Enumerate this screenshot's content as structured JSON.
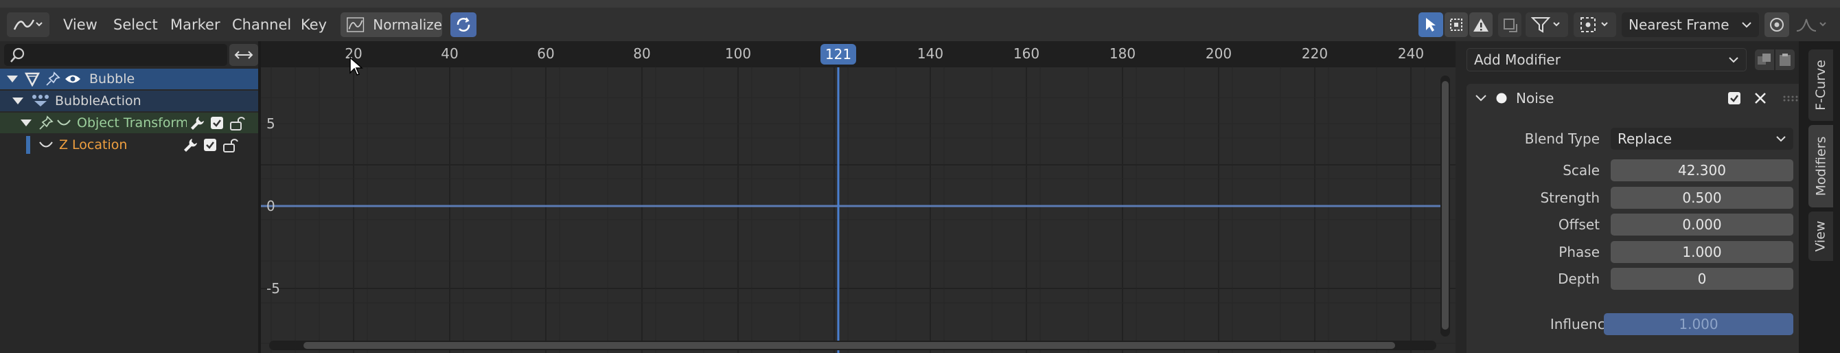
{
  "header": {
    "menus": [
      "View",
      "Select",
      "Marker",
      "Channel",
      "Key"
    ],
    "normalize_label": "Normalize",
    "snap_mode": "Nearest Frame"
  },
  "channels": {
    "object": "Bubble",
    "action": "BubbleAction",
    "group": "Object Transform",
    "fcurve": "Z Location"
  },
  "graph": {
    "x_ticks": [
      "20",
      "40",
      "60",
      "80",
      "100",
      "120",
      "140",
      "160",
      "180",
      "200",
      "220",
      "240"
    ],
    "current_frame": "121",
    "y_ticks": [
      "5",
      "0",
      "-5"
    ]
  },
  "panel": {
    "add_modifier": "Add Modifier",
    "modifier_name": "Noise",
    "blend_type_label": "Blend Type",
    "blend_type_value": "Replace",
    "props": [
      {
        "label": "Scale",
        "value": "42.300"
      },
      {
        "label": "Strength",
        "value": "0.500"
      },
      {
        "label": "Offset",
        "value": "0.000"
      },
      {
        "label": "Phase",
        "value": "1.000"
      },
      {
        "label": "Depth",
        "value": "0"
      }
    ],
    "influence_label": "Influence",
    "influence_value": "1.000"
  },
  "tabs": [
    "F-Curve",
    "Modifiers",
    "View"
  ],
  "colors": {
    "accent": "#4772b3",
    "object_text": "#f0c34a",
    "fcurve_text": "#f0a040",
    "group_text": "#9ccf9c",
    "curve": "#5b7bb5"
  }
}
